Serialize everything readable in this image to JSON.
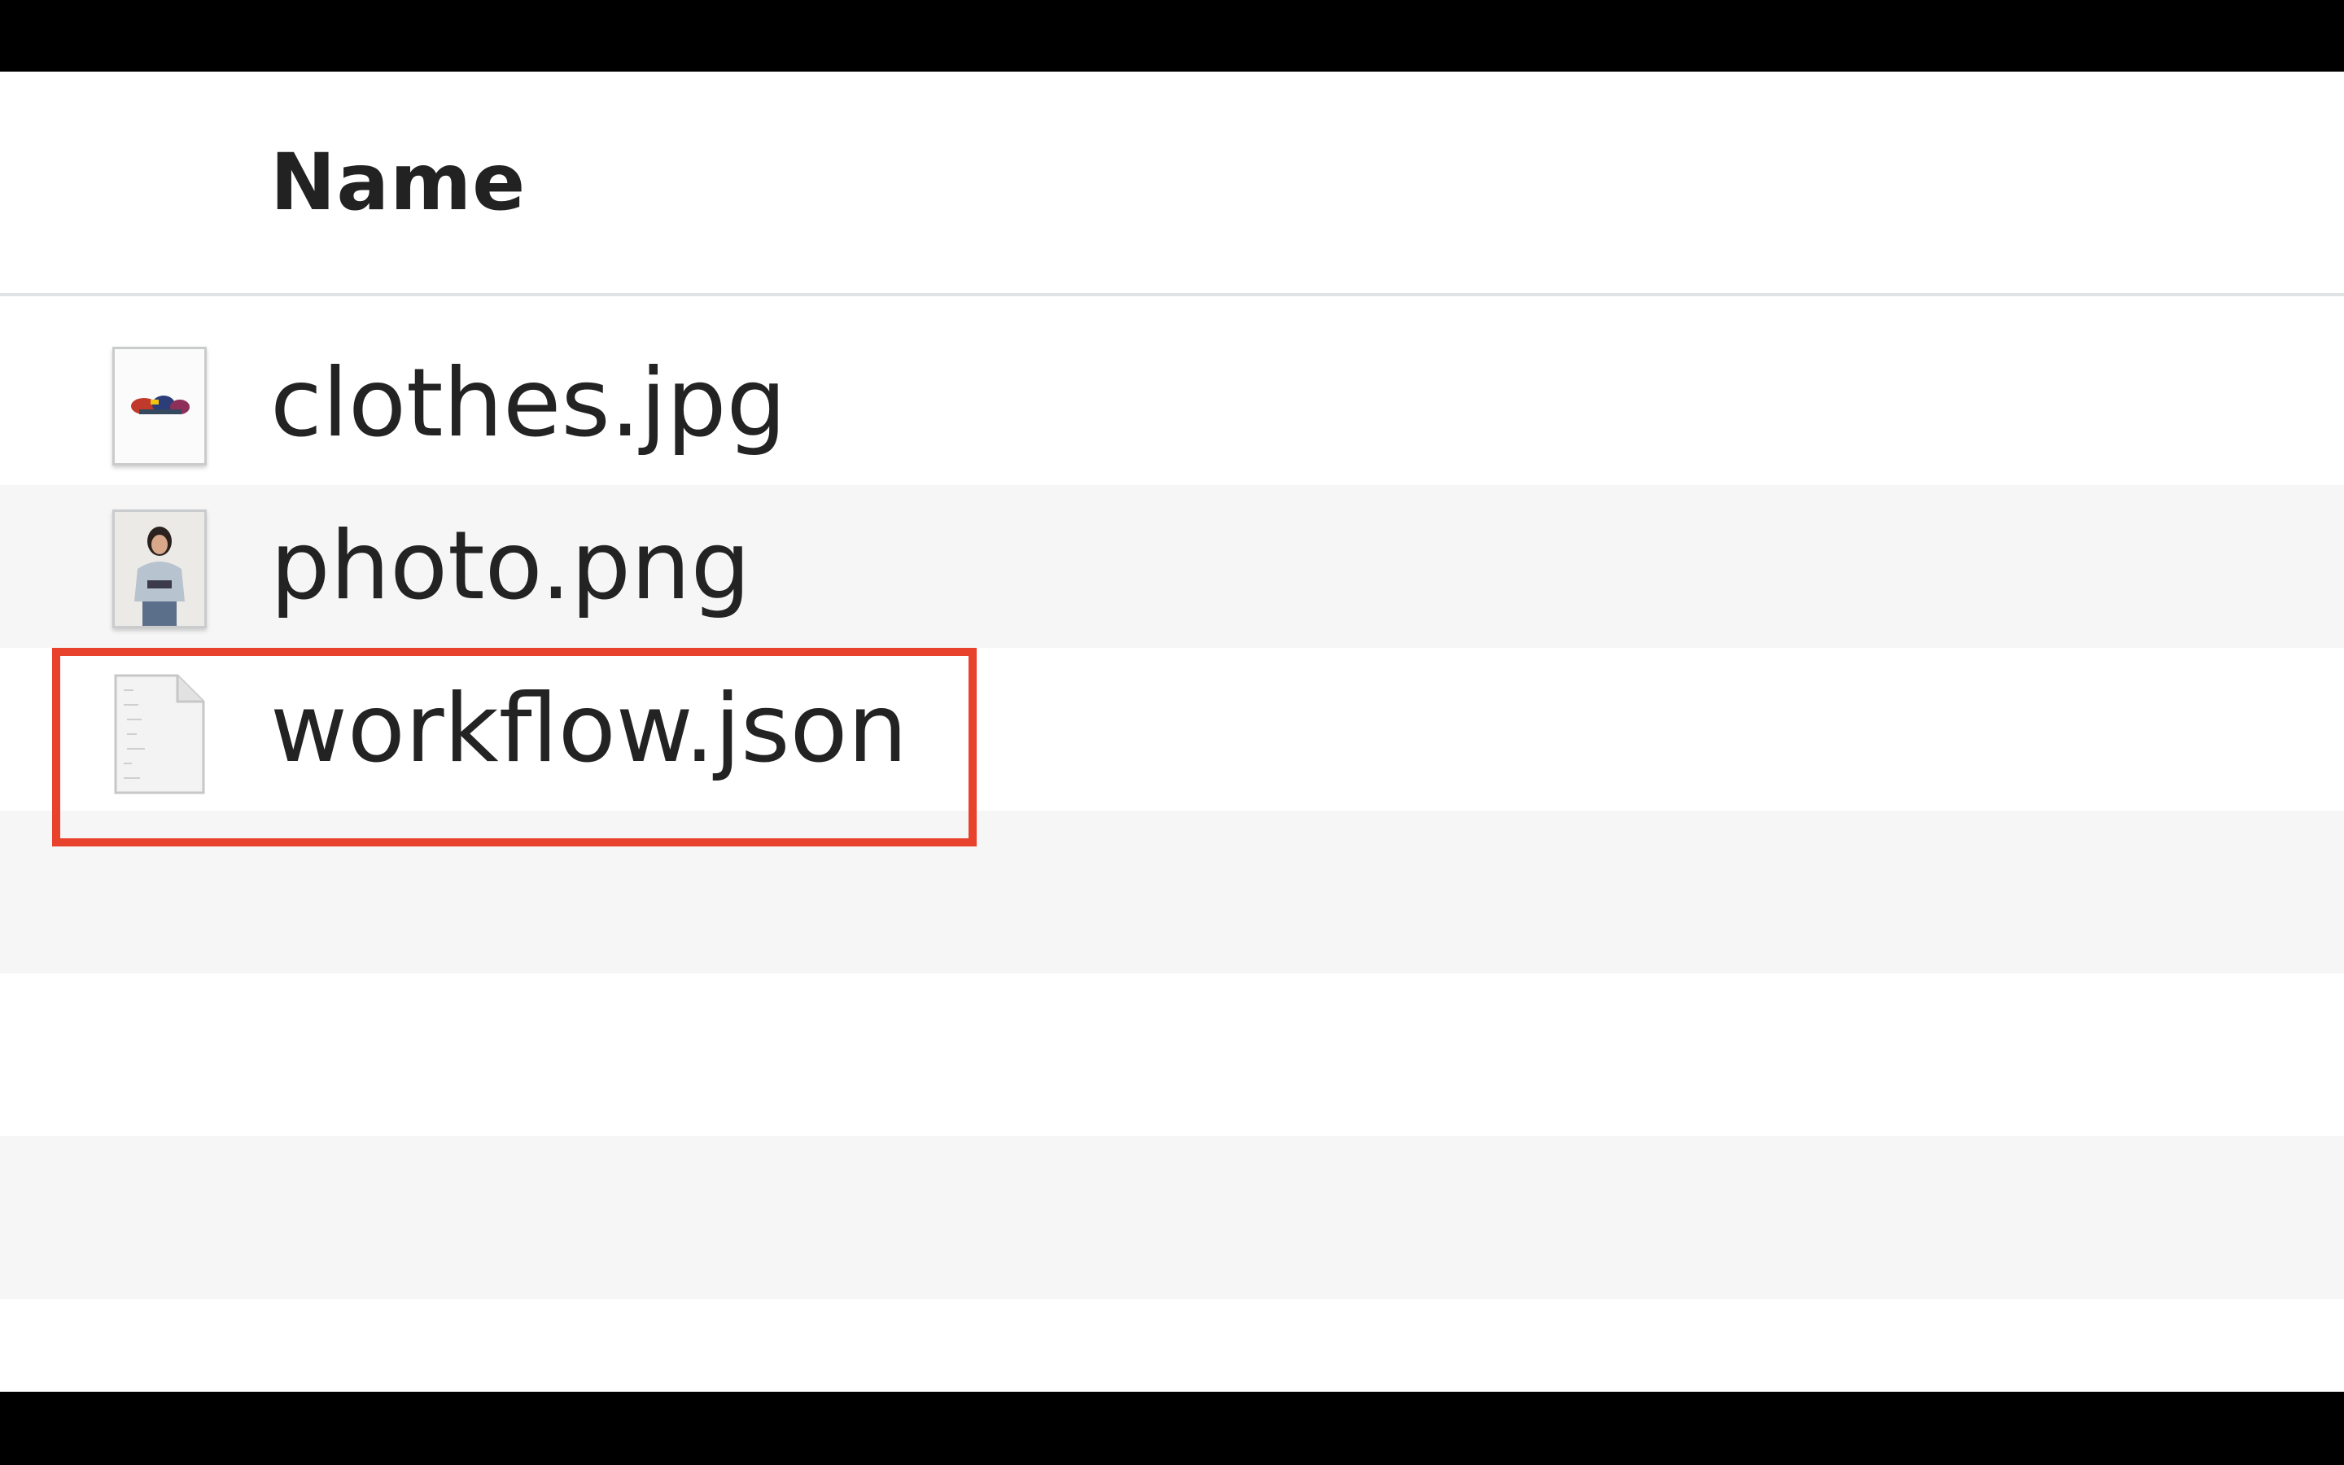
{
  "header": {
    "name_label": "Name"
  },
  "files": [
    {
      "name": "clothes.jpg",
      "icon": "image-thumbnail-icon"
    },
    {
      "name": "photo.png",
      "icon": "photo-thumbnail-icon"
    },
    {
      "name": "workflow.json",
      "icon": "document-icon"
    }
  ],
  "highlight": {
    "target": "workflow.json",
    "color": "#e8412c"
  }
}
